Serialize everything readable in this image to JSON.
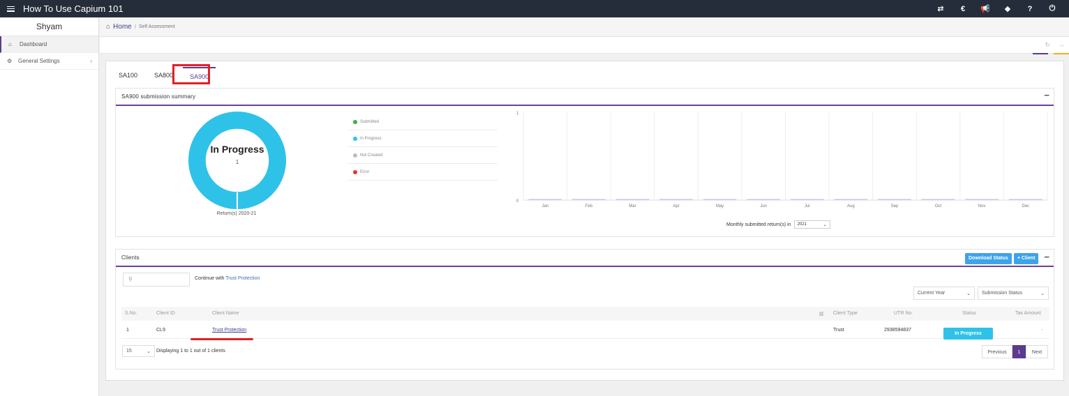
{
  "app": {
    "title": "How To Use Capium 101"
  },
  "top_icons": [
    {
      "name": "transfer-icon",
      "glyph": "⇄"
    },
    {
      "name": "currency-icon",
      "glyph": "€"
    },
    {
      "name": "megaphone-icon",
      "glyph": "📢"
    },
    {
      "name": "tag-icon",
      "glyph": "◆"
    },
    {
      "name": "help-icon",
      "glyph": "?"
    },
    {
      "name": "power-icon",
      "glyph": "⏻"
    }
  ],
  "sidebar": {
    "user": "Shyam",
    "items": [
      {
        "label": "Dashboard",
        "icon": "home-icon"
      },
      {
        "label": "General Settings",
        "icon": "settings-icon"
      }
    ]
  },
  "breadcrumb": {
    "home": "Home",
    "separator": "/",
    "current": "Self Assessment"
  },
  "tabs": [
    "SA100",
    "SA800",
    "SA900"
  ],
  "summary": {
    "title": "SA900 submission summary",
    "donut_title": "In Progress",
    "donut_count": "1",
    "donut_caption": "Return(s) 2020-21",
    "legend": [
      {
        "label": "Submitted",
        "color": "#3cb043"
      },
      {
        "label": "In Progress",
        "color": "#2fc2e8"
      },
      {
        "label": "Not Created",
        "color": "#bdbdbd"
      },
      {
        "label": "Error",
        "color": "#e03a2f"
      }
    ],
    "monthly_label": "Monthly submitted return(s) in",
    "year": "2021"
  },
  "chart_data": {
    "type": "bar",
    "categories": [
      "Jan",
      "Feb",
      "Mar",
      "Apr",
      "May",
      "Jun",
      "Jul",
      "Aug",
      "Sep",
      "Oct",
      "Nov",
      "Dec"
    ],
    "values": [
      0,
      0,
      0,
      0,
      0,
      0,
      0,
      0,
      0,
      0,
      0,
      0
    ],
    "ylim": [
      0,
      1
    ],
    "yticks": [
      "1",
      "0"
    ],
    "grid": true,
    "bar_color": "#c9c5e8"
  },
  "clients": {
    "title": "Clients",
    "download_btn": "Download Status",
    "add_btn": "+ Client",
    "continue_prefix": "Continue with",
    "continue_link": "Trust Protection",
    "year_filter": "Current Year",
    "status_filter": "Submission Status",
    "columns": [
      "S.No.",
      "Client ID",
      "Client Name",
      "Client Type",
      "UTR No.",
      "Status",
      "Tax Amount"
    ],
    "rows": [
      {
        "sno": "1",
        "id": "CL9",
        "name": "Trust Protection",
        "type": "Trust",
        "utr": "2938594837",
        "status": "In Progress",
        "tax": "-"
      }
    ],
    "page_size": "15",
    "displaying": "Displaying 1 to 1 out of 1 clients",
    "prev": "Previous",
    "page": "1",
    "next": "Next"
  }
}
